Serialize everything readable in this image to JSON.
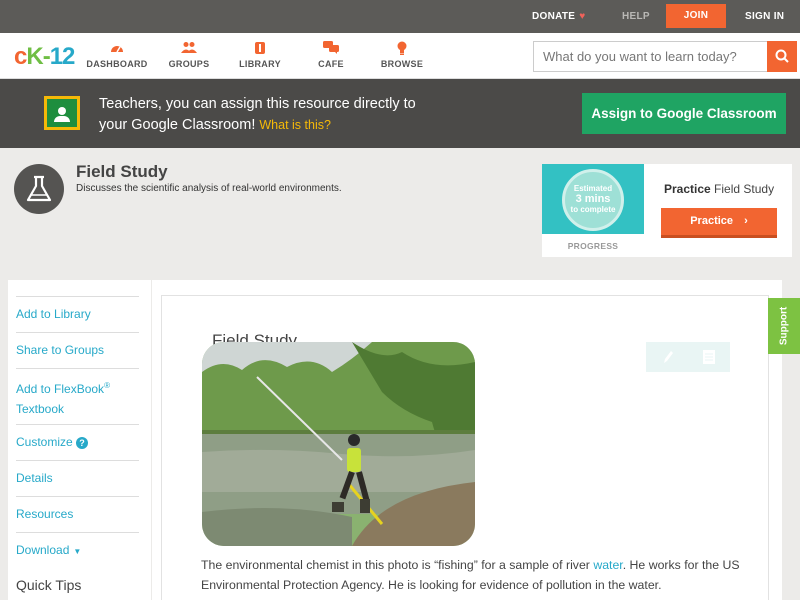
{
  "topbar": {
    "donate": "DONATE",
    "help": "HELP",
    "join": "JOIN",
    "signin": "SIGN IN"
  },
  "nav": {
    "logo": {
      "c": "c",
      "k": "K",
      "dash": "-",
      "num": "12"
    },
    "items": [
      {
        "label": "DASHBOARD",
        "icon": "gauge-icon"
      },
      {
        "label": "GROUPS",
        "icon": "people-icon"
      },
      {
        "label": "LIBRARY",
        "icon": "book-icon"
      },
      {
        "label": "CAFE",
        "icon": "chat-icon"
      },
      {
        "label": "BROWSE",
        "icon": "bulb-icon"
      }
    ],
    "search_placeholder": "What do you want to learn today?"
  },
  "banner": {
    "line1": "Teachers, you can assign this resource directly to",
    "line2": "your Google Classroom!",
    "what": "What is this?",
    "button": "Assign to Google Classroom"
  },
  "hero": {
    "title": "Field Study",
    "description": "Discusses the scientific analysis of real-world environments."
  },
  "practice": {
    "estimated": "Estimated",
    "mins": "3 mins",
    "complete": "to complete",
    "progress_label": "PROGRESS",
    "title_bold": "Practice",
    "title_rest": "Field Study",
    "button": "Practice"
  },
  "sidebar": {
    "add_library": "Add to Library",
    "share_groups": "Share to Groups",
    "add_flexbook_1": "Add to FlexBook",
    "reg": "®",
    "add_flexbook_2": "Textbook",
    "customize": "Customize",
    "help_mark": "?",
    "details": "Details",
    "resources": "Resources",
    "download": "Download",
    "download_arrow": "▼",
    "quick_tips": "Quick Tips"
  },
  "content": {
    "title": "Field Study",
    "para_1": "The environmental chemist in this photo is “fishing” for a sample of river ",
    "para_link": "water",
    "para_2": ". He works for the US Environmental Protection Agency. He is looking for evidence of pollution in the water."
  },
  "support": "Support",
  "colors": {
    "accent": "#f26531",
    "link": "#27a9c9",
    "classroom_green": "#1fa463",
    "support_green": "#7dc242"
  }
}
